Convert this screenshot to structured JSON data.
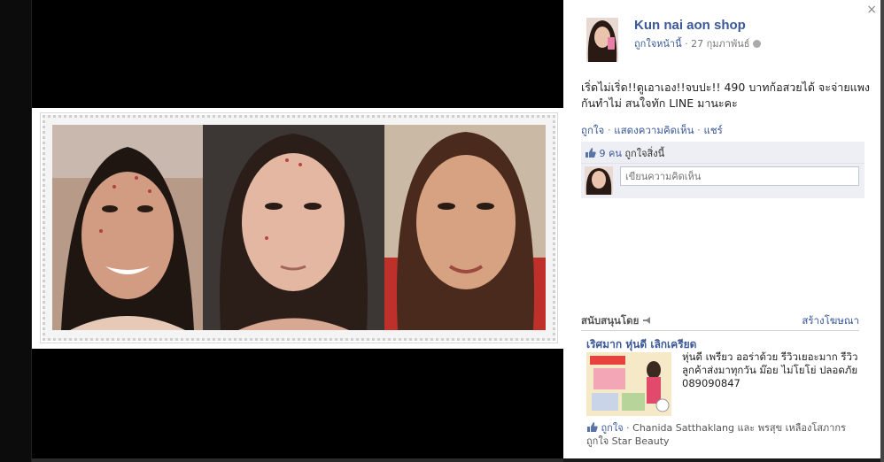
{
  "post": {
    "page_name": "Kun nai aon shop",
    "like_page_label": "ถูกใจหน้านี้",
    "date": "27 กุมภาพันธ์",
    "text": "เริ่ดไม่เริ่ด!!ดูเอาเอง!!จบปะ!! 490 บาทก้อสวยได้ จะจ่ายแพงกันทำไม่ สนใจทัก LINE มานะคะ",
    "actions": {
      "like": "ถูกใจ",
      "comment": "แสดงความคิดเห็น",
      "share": "แชร์"
    },
    "likes_count": "9 คน",
    "likes_text": "ถูกใจสิ่งนี้",
    "comment_placeholder": "เขียนความคิดเห็น"
  },
  "sponsored": {
    "label": "สนับสนุนโดย",
    "create_ad": "สร้างโฆษณา",
    "ad": {
      "title": "เริศมาก หุ่นดี เลิกเครียด",
      "body": "หุ่นดี เพรียว ออร่าด้วย รีวิวเยอะมาก รีวิวลูกค้าส่งมาทุกวัน ม๊อย ไม่โยโย่ ปลอดภัย 089090847",
      "social_like": "ถูกใจ",
      "social_text": "Chanida Satthaklang และ พรสุข เหลืองโสภากร ถูกใจ Star Beauty"
    }
  },
  "viewer": {
    "close_symbol": "×"
  },
  "icons": {
    "close": "close-icon",
    "globe": "globe-icon",
    "thumb": "thumbs-up-icon",
    "sponsored": "sponsored-icon"
  },
  "colors": {
    "link": "#3b5998",
    "likes_box": "#edeff4",
    "overlay": "#000000"
  }
}
